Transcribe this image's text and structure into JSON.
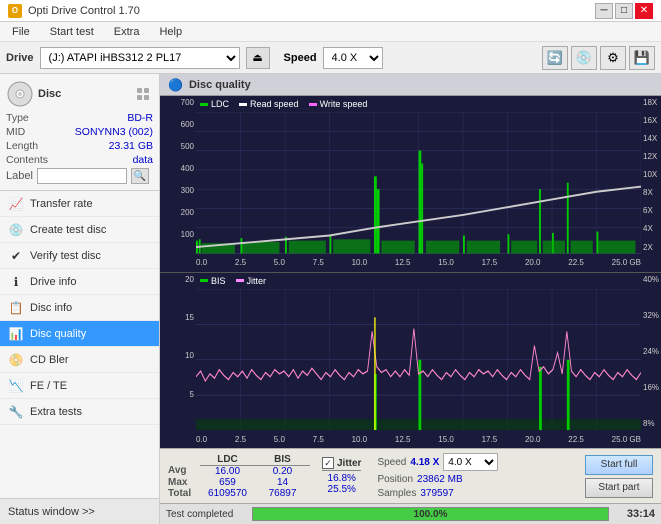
{
  "app": {
    "title": "Opti Drive Control 1.70",
    "icon": "O"
  },
  "titlebar": {
    "minimize": "─",
    "maximize": "□",
    "close": "✕"
  },
  "menu": {
    "items": [
      "File",
      "Start test",
      "Extra",
      "Help"
    ]
  },
  "drive_bar": {
    "label": "Drive",
    "drive_value": "(J:) ATAPI iHBS312  2 PL17",
    "speed_label": "Speed",
    "speed_value": "4.0 X"
  },
  "disc": {
    "title": "Disc",
    "type_label": "Type",
    "type_value": "BD-R",
    "mid_label": "MID",
    "mid_value": "SONYNN3 (002)",
    "length_label": "Length",
    "length_value": "23.31 GB",
    "contents_label": "Contents",
    "contents_value": "data",
    "label_label": "Label",
    "label_value": ""
  },
  "nav": {
    "items": [
      {
        "id": "transfer-rate",
        "label": "Transfer rate",
        "icon": "📈"
      },
      {
        "id": "create-test-disc",
        "label": "Create test disc",
        "icon": "💿"
      },
      {
        "id": "verify-test-disc",
        "label": "Verify test disc",
        "icon": "✔"
      },
      {
        "id": "drive-info",
        "label": "Drive info",
        "icon": "ℹ"
      },
      {
        "id": "disc-info",
        "label": "Disc info",
        "icon": "📋"
      },
      {
        "id": "disc-quality",
        "label": "Disc quality",
        "icon": "📊",
        "active": true
      },
      {
        "id": "cd-bler",
        "label": "CD Bler",
        "icon": "📀"
      },
      {
        "id": "fe-te",
        "label": "FE / TE",
        "icon": "📉"
      },
      {
        "id": "extra-tests",
        "label": "Extra tests",
        "icon": "🔧"
      }
    ]
  },
  "status_window": {
    "label": "Status window >>"
  },
  "disc_quality": {
    "title": "Disc quality",
    "chart_top": {
      "legend": [
        {
          "label": "LDC",
          "color": "#00cc00"
        },
        {
          "label": "Read speed",
          "color": "#ffffff"
        },
        {
          "label": "Write speed",
          "color": "#ff66ff"
        }
      ],
      "y_labels": [
        "700",
        "600",
        "500",
        "400",
        "300",
        "200",
        "100",
        "0.0"
      ],
      "y_labels_right": [
        "18X",
        "16X",
        "14X",
        "12X",
        "10X",
        "8X",
        "6X",
        "4X",
        "2X"
      ],
      "x_labels": [
        "0.0",
        "2.5",
        "5.0",
        "7.5",
        "10.0",
        "12.5",
        "15.0",
        "17.5",
        "20.0",
        "22.5",
        "25.0 GB"
      ]
    },
    "chart_bottom": {
      "legend": [
        {
          "label": "BIS",
          "color": "#00cc00"
        },
        {
          "label": "Jitter",
          "color": "#ff88ff"
        }
      ],
      "y_labels": [
        "20",
        "15",
        "10",
        "5",
        ""
      ],
      "y_labels_right": [
        "40%",
        "32%",
        "24%",
        "16%",
        "8%"
      ],
      "x_labels": [
        "0.0",
        "2.5",
        "5.0",
        "7.5",
        "10.0",
        "12.5",
        "15.0",
        "17.5",
        "20.0",
        "22.5",
        "25.0 GB"
      ]
    }
  },
  "stats": {
    "columns": [
      "LDC",
      "BIS"
    ],
    "jitter_label": "Jitter",
    "jitter_checked": true,
    "rows": [
      {
        "label": "Avg",
        "ldc": "16.00",
        "bis": "0.20",
        "jitter": "16.8%"
      },
      {
        "label": "Max",
        "ldc": "659",
        "bis": "14",
        "jitter": "25.5%"
      },
      {
        "label": "Total",
        "ldc": "6109570",
        "bis": "76897",
        "jitter": ""
      }
    ],
    "speed_label": "Speed",
    "speed_value": "4.18 X",
    "speed_select": "4.0 X",
    "position_label": "Position",
    "position_value": "23862 MB",
    "samples_label": "Samples",
    "samples_value": "379597",
    "start_full": "Start full",
    "start_part": "Start part"
  },
  "progress": {
    "status_text": "Test completed",
    "percent": "100.0%",
    "time": "33:14"
  }
}
